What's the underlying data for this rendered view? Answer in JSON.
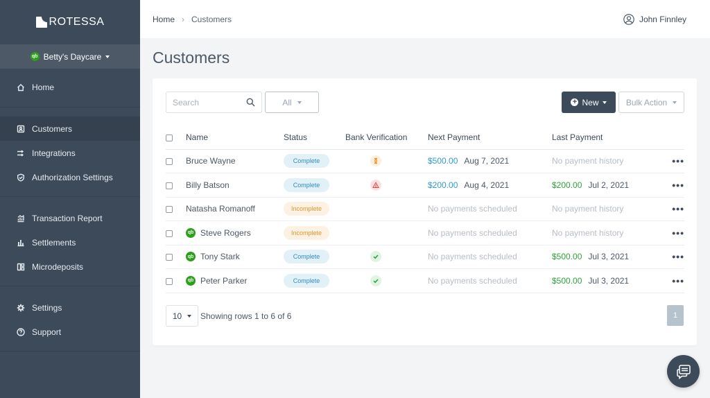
{
  "brand": {
    "name": "ROTESSA"
  },
  "org": {
    "name": "Betty's Daycare",
    "icon": "quickbooks-icon"
  },
  "sidebar": {
    "groups": [
      [
        {
          "label": "Home",
          "icon": "home-icon"
        }
      ],
      [
        {
          "label": "Customers",
          "icon": "customers-icon",
          "active": true
        },
        {
          "label": "Integrations",
          "icon": "integrations-icon"
        },
        {
          "label": "Authorization Settings",
          "icon": "shield-icon"
        }
      ],
      [
        {
          "label": "Transaction Report",
          "icon": "transaction-report-icon"
        },
        {
          "label": "Settlements",
          "icon": "bar-chart-icon"
        },
        {
          "label": "Microdeposits",
          "icon": "microdeposits-icon"
        }
      ],
      [
        {
          "label": "Settings",
          "icon": "gear-icon"
        },
        {
          "label": "Support",
          "icon": "help-icon"
        }
      ]
    ]
  },
  "header": {
    "breadcrumb": [
      "Home",
      "Customers"
    ],
    "user": "John Finnley"
  },
  "page": {
    "title": "Customers"
  },
  "toolbar": {
    "search_placeholder": "Search",
    "filter_value": "All",
    "new_label": "New",
    "bulk_label": "Bulk Action"
  },
  "table": {
    "columns": [
      "Name",
      "Status",
      "Bank Verification",
      "Next Payment",
      "Last Payment"
    ],
    "rows": [
      {
        "name": "Bruce Wayne",
        "qb": false,
        "status": "Complete",
        "bank": "pending",
        "next_amount": "$500.00",
        "next_date": "Aug 7, 2021",
        "next_empty": "",
        "last_amount": "",
        "last_date": "",
        "last_empty": "No payment history"
      },
      {
        "name": "Billy Batson",
        "qb": false,
        "status": "Complete",
        "bank": "failed",
        "next_amount": "$200.00",
        "next_date": "Aug 4, 2021",
        "next_empty": "",
        "last_amount": "$200.00",
        "last_date": "Jul 2, 2021",
        "last_empty": ""
      },
      {
        "name": "Natasha Romanoff",
        "qb": false,
        "status": "Incomplete",
        "bank": "none",
        "next_amount": "",
        "next_date": "",
        "next_empty": "No payments scheduled",
        "last_amount": "",
        "last_date": "",
        "last_empty": "No payment history"
      },
      {
        "name": "Steve Rogers",
        "qb": true,
        "status": "Incomplete",
        "bank": "none",
        "next_amount": "",
        "next_date": "",
        "next_empty": "No payments scheduled",
        "last_amount": "",
        "last_date": "",
        "last_empty": "No payment history"
      },
      {
        "name": "Tony Stark",
        "qb": true,
        "status": "Complete",
        "bank": "verified",
        "next_amount": "",
        "next_date": "",
        "next_empty": "No payments scheduled",
        "last_amount": "$500.00",
        "last_date": "Jul 3, 2021",
        "last_empty": ""
      },
      {
        "name": "Peter Parker",
        "qb": true,
        "status": "Complete",
        "bank": "verified",
        "next_amount": "",
        "next_date": "",
        "next_empty": "No payments scheduled",
        "last_amount": "$500.00",
        "last_date": "Jul 3, 2021",
        "last_empty": ""
      }
    ]
  },
  "footer": {
    "page_size": "10",
    "rows_info": "Showing rows 1 to 6 of 6",
    "current_page": "1"
  },
  "colors": {
    "sidebar": "#3d4a59",
    "accent_blue": "#2d9ccf",
    "accent_green": "#2da33a",
    "incomplete_orange": "#e59533"
  }
}
